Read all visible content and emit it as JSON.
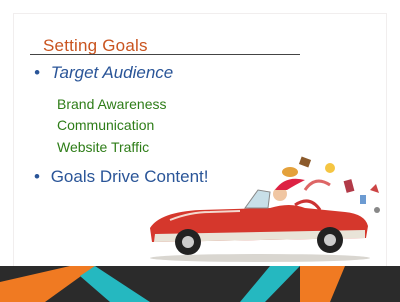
{
  "slide": {
    "title": "Setting Goals",
    "bullets": [
      {
        "text": "Target Audience"
      },
      {
        "text": "Goals Drive Content!"
      }
    ],
    "sub_items": [
      "Brand Awareness",
      "Communication",
      "Website Traffic"
    ]
  },
  "icons": {
    "bullet": "bullet-dot-icon",
    "car": "convertible-car-illustration"
  },
  "colors": {
    "title": "#c9541f",
    "bullet_text": "#2a5598",
    "sub_text": "#2e7d18",
    "footer_orange": "#f07a22",
    "footer_teal": "#25b8c0",
    "footer_dark": "#2b2b2b"
  }
}
